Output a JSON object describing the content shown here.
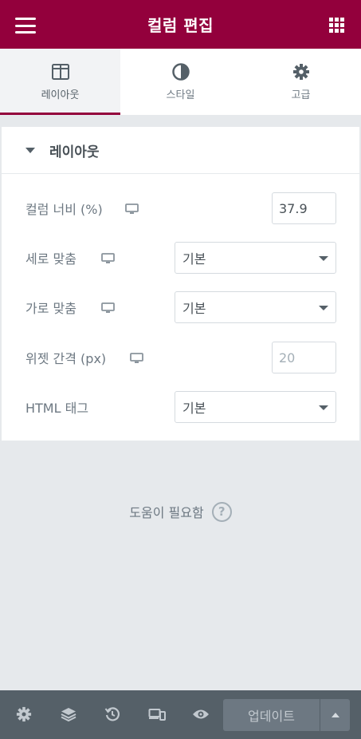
{
  "header": {
    "title": "컬럼 편집",
    "menu_icon": "hamburger-icon",
    "widgets_icon": "grid-icon",
    "brand_color": "#93003c"
  },
  "tabs": [
    {
      "label": "레이아웃",
      "icon": "columns-icon",
      "active": true
    },
    {
      "label": "스타일",
      "icon": "contrast-icon",
      "active": false
    },
    {
      "label": "고급",
      "icon": "gear-icon",
      "active": false
    }
  ],
  "section": {
    "title": "레이아웃",
    "controls": {
      "column_width": {
        "label": "컬럼 너비 (%)",
        "value": "37.9",
        "icon": "monitor-icon"
      },
      "vertical_align": {
        "label": "세로 맞춤",
        "value": "기본",
        "icon": "monitor-icon"
      },
      "horizontal_align": {
        "label": "가로 맞춤",
        "value": "기본",
        "icon": "monitor-icon"
      },
      "widget_gap": {
        "label": "위젯 간격 (px)",
        "placeholder": "20",
        "icon": "monitor-icon"
      },
      "html_tag": {
        "label": "HTML 태그",
        "value": "기본"
      }
    }
  },
  "help": {
    "label": "도움이 필요함",
    "icon": "question-icon"
  },
  "footer": {
    "icons": [
      "settings-icon",
      "layers-icon",
      "history-icon",
      "responsive-icon",
      "eye-icon"
    ],
    "update_label": "업데이트"
  }
}
